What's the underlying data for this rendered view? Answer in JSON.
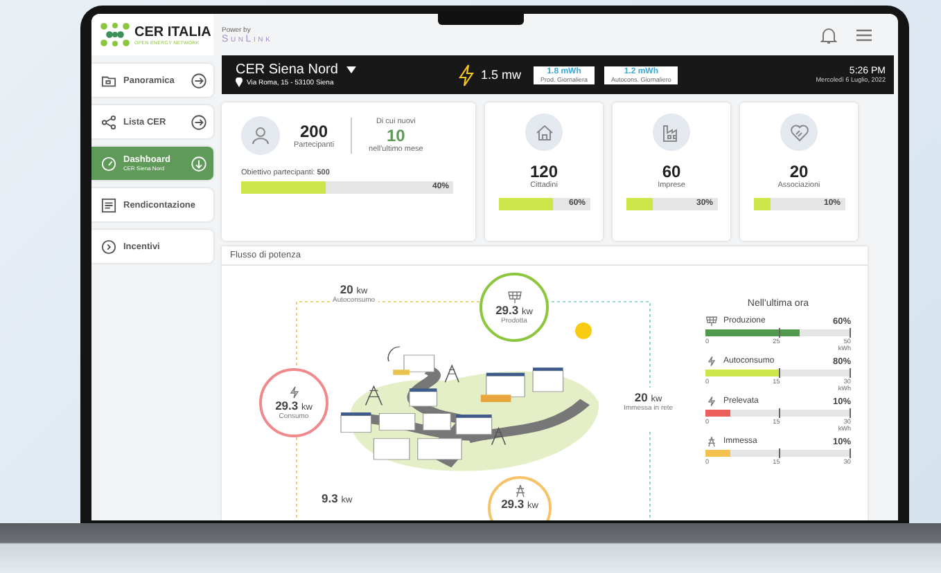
{
  "logo": {
    "name": "CER ITALIA",
    "tagline": "OPEN ENERGY NETWORK"
  },
  "powered": {
    "label": "Power by",
    "brand": "SunLink"
  },
  "sidebar": {
    "items": [
      {
        "kind": "folder",
        "label": "Panoramica",
        "selected": false,
        "arrow": true
      },
      {
        "kind": "share",
        "label": "Lista CER",
        "selected": false,
        "arrow": true
      },
      {
        "kind": "gauge",
        "label": "Dashboard",
        "subtitle": "CER Siena Nord",
        "selected": true,
        "arrow": true
      },
      {
        "kind": "report",
        "label": "Rendicontazione",
        "selected": false,
        "arrow": false
      },
      {
        "kind": "coin",
        "label": "Incentivi",
        "selected": false,
        "arrow": false
      }
    ]
  },
  "header": {
    "cer": "CER Siena Nord",
    "address": "Via Roma, 15 - 53100 Siena",
    "power": "1.5 mw",
    "stats": [
      {
        "value": "1.8 mWh",
        "label": "Prod. Giornaliera"
      },
      {
        "value": "1.2 mWh",
        "label": "Autocons. Giornaliero"
      }
    ],
    "time": "5:26 PM",
    "date": "Mercoledì 6 Luglio, 2022"
  },
  "participants": {
    "count": "200",
    "count_label": "Partecipanti",
    "new_label": "Di cui nuovi",
    "new_count": "10",
    "new_period": "nell'ultimo mese",
    "goal_label": "Obiettivo partecipanti:",
    "goal": "500",
    "level": 0.4,
    "percent": "40%"
  },
  "categories": [
    {
      "kind": "house",
      "count": "120",
      "label": "Cittadini",
      "level": 0.6,
      "percent": "60%"
    },
    {
      "kind": "factory",
      "count": "60",
      "label": "Imprese",
      "level": 0.3,
      "percent": "30%"
    },
    {
      "kind": "heart",
      "count": "20",
      "label": "Associazioni",
      "level": 0.19,
      "percent": "10%"
    }
  ],
  "flow": {
    "title": "Flusso di potenza",
    "nodes": [
      {
        "kind": "produced",
        "value": "29.3",
        "unit": "kw",
        "label": "Prodotta"
      },
      {
        "kind": "consumed",
        "value": "29.3",
        "unit": "kw",
        "label": "Consumo"
      },
      {
        "kind": "grid",
        "value": "29.3",
        "unit": "kw"
      }
    ],
    "labels": [
      {
        "kind": "self",
        "value": "20",
        "unit": "kw",
        "label": "Autoconsumo"
      },
      {
        "kind": "exported",
        "value": "20",
        "unit": "kw",
        "label": "Immessa in rete"
      },
      {
        "kind": "withdrawn",
        "value": "9.3",
        "unit": "kw"
      }
    ]
  },
  "last_hour": {
    "title": "Nell'ultima ora",
    "rows": [
      {
        "kind": "solar",
        "label": "Produzione",
        "percent": "60%",
        "level": 0.65,
        "color": "#4f9a4e",
        "ticks": [
          "0",
          "25",
          "50"
        ],
        "unit": "kWh"
      },
      {
        "kind": "bolt",
        "label": "Autoconsumo",
        "percent": "80%",
        "level": 0.51,
        "color": "#cde64a",
        "ticks": [
          "0",
          "15",
          "30"
        ],
        "unit": "kWh"
      },
      {
        "kind": "bolt",
        "label": "Prelevata",
        "percent": "10%",
        "level": 0.17,
        "color": "#ec5f5a",
        "ticks": [
          "0",
          "15",
          "30"
        ],
        "unit": "kWh"
      },
      {
        "kind": "pylon",
        "label": "Immessa",
        "percent": "10%",
        "level": 0.17,
        "color": "#f2c14e",
        "ticks": [
          "0",
          "15",
          "30"
        ]
      }
    ]
  }
}
